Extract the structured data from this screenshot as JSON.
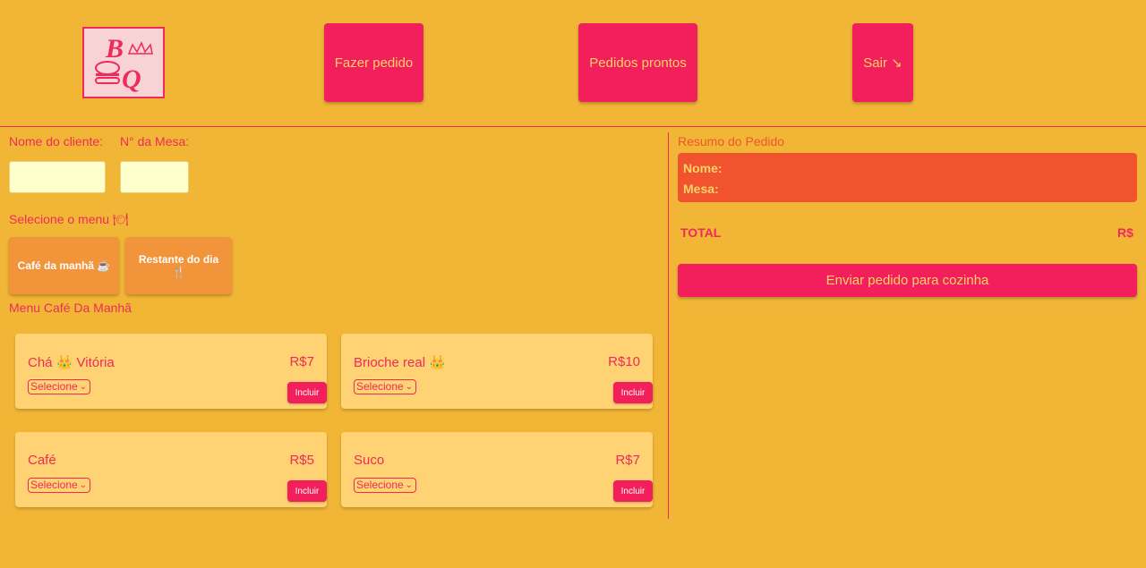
{
  "header": {
    "nav": {
      "new_order": "Fazer pedido",
      "ready_orders": "Pedidos prontos",
      "logout": "Sair ↘"
    }
  },
  "order_form": {
    "client_name_label": "Nome do cliente:",
    "table_label": "N° da Mesa:",
    "select_menu_label": "Selecione o menu 🍽",
    "menu_buttons": [
      "Café da manhã ☕",
      "Restante do dia 🍴"
    ],
    "menu_title": "Menu Café Da Manhã",
    "select_placeholder": "Selecione",
    "add_label": "Incluir",
    "items": [
      {
        "name": "Chá 👑 Vitória",
        "price": "R$7"
      },
      {
        "name": "Brioche real 👑",
        "price": "R$10"
      },
      {
        "name": "Café",
        "price": "R$5"
      },
      {
        "name": "Suco",
        "price": "R$7"
      }
    ]
  },
  "summary": {
    "title": "Resumo do Pedido",
    "name_label": "Nome:",
    "table_label": "Mesa:",
    "total_label": "TOTAL",
    "total_value": "R$",
    "send_label": "Enviar pedido para cozinha"
  },
  "colors": {
    "background": "#f2b636",
    "primary": "#f21f5c",
    "text_accent": "#ee2b5a",
    "card": "#ffd373",
    "summary_box": "#f2532f",
    "menu_button": "#f2943a"
  }
}
